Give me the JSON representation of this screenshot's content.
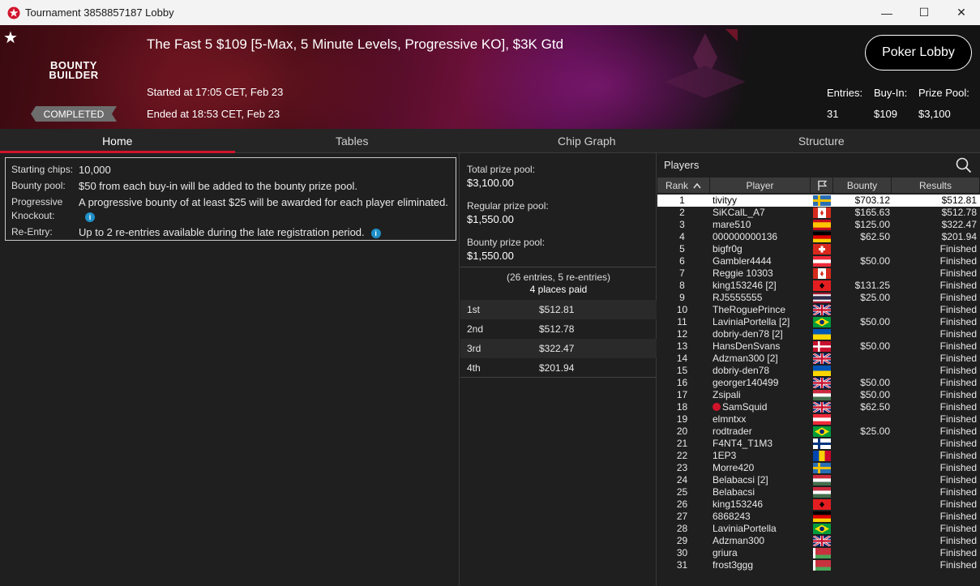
{
  "window": {
    "title": "Tournament 3858857187 Lobby",
    "minimize": "—",
    "maximize": "☐",
    "close": "✕"
  },
  "banner": {
    "logo_line1": "BOUNTY",
    "logo_line2": "BUILDER",
    "status": "COMPLETED",
    "title": "The Fast 5 $109 [5-Max, 5 Minute Levels, Progressive KO], $3K Gtd",
    "started": "Started at 17:05 CET, Feb 23",
    "ended": "Ended at 18:53 CET, Feb 23",
    "lobby_button": "Poker Lobby",
    "entries_label": "Entries:",
    "entries_value": "31",
    "buyin_label": "Buy-In:",
    "buyin_value": "$109",
    "prizepool_label": "Prize Pool:",
    "prizepool_value": "$3,100"
  },
  "tabs": [
    "Home",
    "Tables",
    "Chip Graph",
    "Structure"
  ],
  "info": {
    "starting_label": "Starting chips:",
    "starting_value": "10,000",
    "bounty_label": "Bounty pool:",
    "bounty_value": "$50 from each buy-in will be added to the bounty prize pool.",
    "pko_label": "Progressive Knockout:",
    "pko_value": "A progressive bounty of at least $25 will be awarded for each player eliminated.",
    "reentry_label": "Re-Entry:",
    "reentry_value": "Up to 2 re-entries available during the late registration period."
  },
  "prize": {
    "total_label": "Total prize pool:",
    "total_value": "$3,100.00",
    "regular_label": "Regular prize pool:",
    "regular_value": "$1,550.00",
    "bounty_label": "Bounty prize pool:",
    "bounty_value": "$1,550.00",
    "entries_line": "(26 entries, 5 re-entries)",
    "places_line": "4 places paid",
    "payouts": [
      {
        "place": "1st",
        "amount": "$512.81"
      },
      {
        "place": "2nd",
        "amount": "$512.78"
      },
      {
        "place": "3rd",
        "amount": "$322.47"
      },
      {
        "place": "4th",
        "amount": "$201.94"
      }
    ]
  },
  "players": {
    "heading": "Players",
    "columns": {
      "rank": "Rank",
      "player": "Player",
      "bounty": "Bounty",
      "results": "Results"
    },
    "rows": [
      {
        "rank": "1",
        "player": "tivityy",
        "flag": "SE",
        "bounty": "$703.12",
        "result": "$512.81"
      },
      {
        "rank": "2",
        "player": "SiKCalL_A7",
        "flag": "CA",
        "bounty": "$165.63",
        "result": "$512.78"
      },
      {
        "rank": "3",
        "player": "mare510",
        "flag": "ES",
        "bounty": "$125.00",
        "result": "$322.47"
      },
      {
        "rank": "4",
        "player": "000000000136",
        "flag": "DE",
        "bounty": "$62.50",
        "result": "$201.94"
      },
      {
        "rank": "5",
        "player": "bigfr0g",
        "flag": "CH",
        "bounty": "",
        "result": "Finished"
      },
      {
        "rank": "6",
        "player": "Gambler4444",
        "flag": "AT",
        "bounty": "$50.00",
        "result": "Finished"
      },
      {
        "rank": "7",
        "player": "Reggie 10303",
        "flag": "CA",
        "bounty": "",
        "result": "Finished"
      },
      {
        "rank": "8",
        "player": "king153246 [2]",
        "flag": "AL",
        "bounty": "$131.25",
        "result": "Finished"
      },
      {
        "rank": "9",
        "player": "RJ5555555",
        "flag": "TH",
        "bounty": "$25.00",
        "result": "Finished"
      },
      {
        "rank": "10",
        "player": "TheRoguePrince",
        "flag": "GB",
        "bounty": "",
        "result": "Finished"
      },
      {
        "rank": "11",
        "player": "LaviniaPortella [2]",
        "flag": "BR",
        "bounty": "$50.00",
        "result": "Finished"
      },
      {
        "rank": "12",
        "player": "dobriy-den78 [2]",
        "flag": "UA",
        "bounty": "",
        "result": "Finished"
      },
      {
        "rank": "13",
        "player": "HansDenSvans",
        "flag": "DK",
        "bounty": "$50.00",
        "result": "Finished"
      },
      {
        "rank": "14",
        "player": "Adzman300 [2]",
        "flag": "GB",
        "bounty": "",
        "result": "Finished"
      },
      {
        "rank": "15",
        "player": "dobriy-den78",
        "flag": "UA",
        "bounty": "",
        "result": "Finished"
      },
      {
        "rank": "16",
        "player": "georger140499",
        "flag": "GB",
        "bounty": "$50.00",
        "result": "Finished"
      },
      {
        "rank": "17",
        "player": "Zsipali",
        "flag": "HU",
        "bounty": "$50.00",
        "result": "Finished"
      },
      {
        "rank": "18",
        "player": "SamSquid",
        "flag": "GB",
        "bounty": "$62.50",
        "result": "Finished",
        "ps": true
      },
      {
        "rank": "19",
        "player": "elmntxx",
        "flag": "AT",
        "bounty": "",
        "result": "Finished"
      },
      {
        "rank": "20",
        "player": "rodtrader",
        "flag": "BR",
        "bounty": "$25.00",
        "result": "Finished"
      },
      {
        "rank": "21",
        "player": "F4NT4_T1M3",
        "flag": "FI",
        "bounty": "",
        "result": "Finished"
      },
      {
        "rank": "22",
        "player": "1EP3",
        "flag": "MD",
        "bounty": "",
        "result": "Finished"
      },
      {
        "rank": "23",
        "player": "Morre420",
        "flag": "SE",
        "bounty": "",
        "result": "Finished"
      },
      {
        "rank": "24",
        "player": "Belabacsi [2]",
        "flag": "HU",
        "bounty": "",
        "result": "Finished"
      },
      {
        "rank": "25",
        "player": "Belabacsi",
        "flag": "HU",
        "bounty": "",
        "result": "Finished"
      },
      {
        "rank": "26",
        "player": "king153246",
        "flag": "AL",
        "bounty": "",
        "result": "Finished"
      },
      {
        "rank": "27",
        "player": "6868243",
        "flag": "DE",
        "bounty": "",
        "result": "Finished"
      },
      {
        "rank": "28",
        "player": "LaviniaPortella",
        "flag": "BR",
        "bounty": "",
        "result": "Finished"
      },
      {
        "rank": "29",
        "player": "Adzman300",
        "flag": "GB",
        "bounty": "",
        "result": "Finished"
      },
      {
        "rank": "30",
        "player": "griura",
        "flag": "BY",
        "bounty": "",
        "result": "Finished"
      },
      {
        "rank": "31",
        "player": "frost3ggg",
        "flag": "BY",
        "bounty": "",
        "result": "Finished"
      }
    ]
  },
  "colors": {
    "accent": "#d1142b",
    "panel": "#1f1f1f",
    "info_icon": "#1e8fc7"
  }
}
